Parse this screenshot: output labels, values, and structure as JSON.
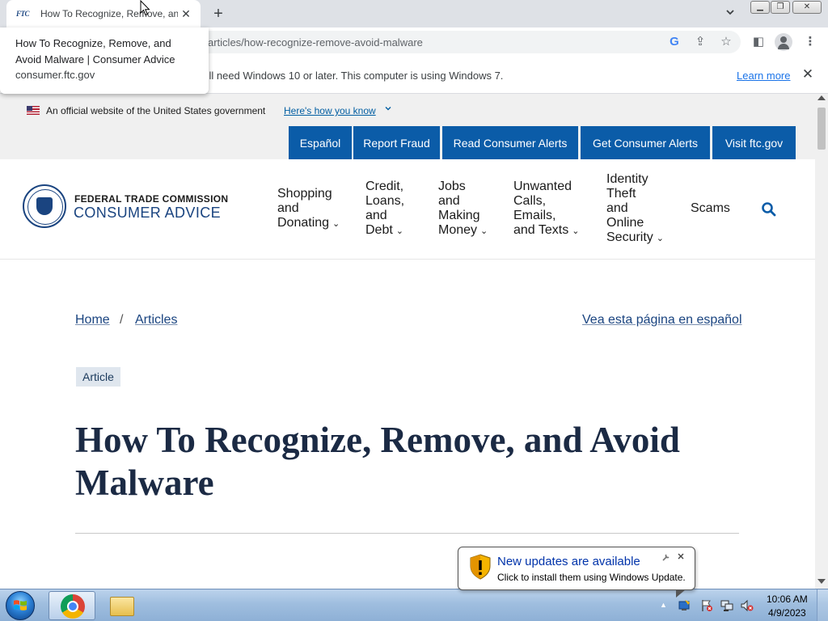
{
  "browser": {
    "tab": {
      "favicon_text": "FTC",
      "title": "How To Recognize, Remove, and Avoid Malware | Consumer Advice",
      "close_glyph": "✕"
    },
    "new_tab_glyph": "+",
    "tab_search_glyph": "⌄",
    "window_buttons": {
      "minimize": "▁",
      "maximize": "❐",
      "close": "✕"
    },
    "url": "articles/how-recognize-remove-avoid-malware",
    "toolbar_icons": {
      "google": "G",
      "share": "⇪",
      "star": "☆",
      "side_panel": "◧",
      "menu": "⋮"
    },
    "hover_card": {
      "title": "How To Recognize, Remove, and Avoid Malware | Consumer Advice",
      "domain": "consumer.ftc.gov"
    },
    "infobar": {
      "text": "'ll need Windows 10 or later. This computer is using Windows 7.",
      "learn_more": "Learn more",
      "close_glyph": "✕"
    }
  },
  "site": {
    "gov_banner": {
      "text": "An official website of the United States government",
      "link": "Here's how you know",
      "chevron": "⌄"
    },
    "utility_nav": [
      "Español",
      "Report Fraud",
      "Read Consumer Alerts",
      "Get Consumer Alerts",
      "Visit ftc.gov"
    ],
    "logo": {
      "top": "FEDERAL TRADE COMMISSION",
      "bottom": "CONSUMER ADVICE"
    },
    "main_nav": [
      {
        "label": "Shopping and Donating",
        "lines": [
          "Shopping",
          "and",
          "Donating"
        ]
      },
      {
        "label": "Credit, Loans, and Debt",
        "lines": [
          "Credit,",
          "Loans,",
          "and",
          "Debt"
        ]
      },
      {
        "label": "Jobs and Making Money",
        "lines": [
          "Jobs",
          "and",
          "Making",
          "Money"
        ]
      },
      {
        "label": "Unwanted Calls, Emails, and Texts",
        "lines": [
          "Unwanted",
          "Calls,",
          "Emails,",
          "and Texts"
        ]
      },
      {
        "label": "Identity Theft and Online Security",
        "lines": [
          "Identity",
          "Theft",
          "and",
          "Online",
          "Security"
        ]
      },
      {
        "label": "Scams"
      }
    ],
    "chevron": "⌄",
    "breadcrumb": {
      "home": "Home",
      "separator": "/",
      "articles": "Articles"
    },
    "spanish_link": "Vea esta página en español",
    "badge": "Article",
    "title": "How To Recognize, Remove, and Avoid Malware"
  },
  "balloon": {
    "title": "New updates are available",
    "text": "Click to install them using Windows Update.",
    "icon": "shield-warning-icon"
  },
  "taskbar": {
    "tray_arrow": "▲",
    "time": "10:06 AM",
    "date": "4/9/2023"
  },
  "colors": {
    "ftc_blue": "#0b5ca8",
    "navy": "#1a4480",
    "chrome_tabstrip": "#dee1e6",
    "link_blue": "#1a73e8"
  }
}
